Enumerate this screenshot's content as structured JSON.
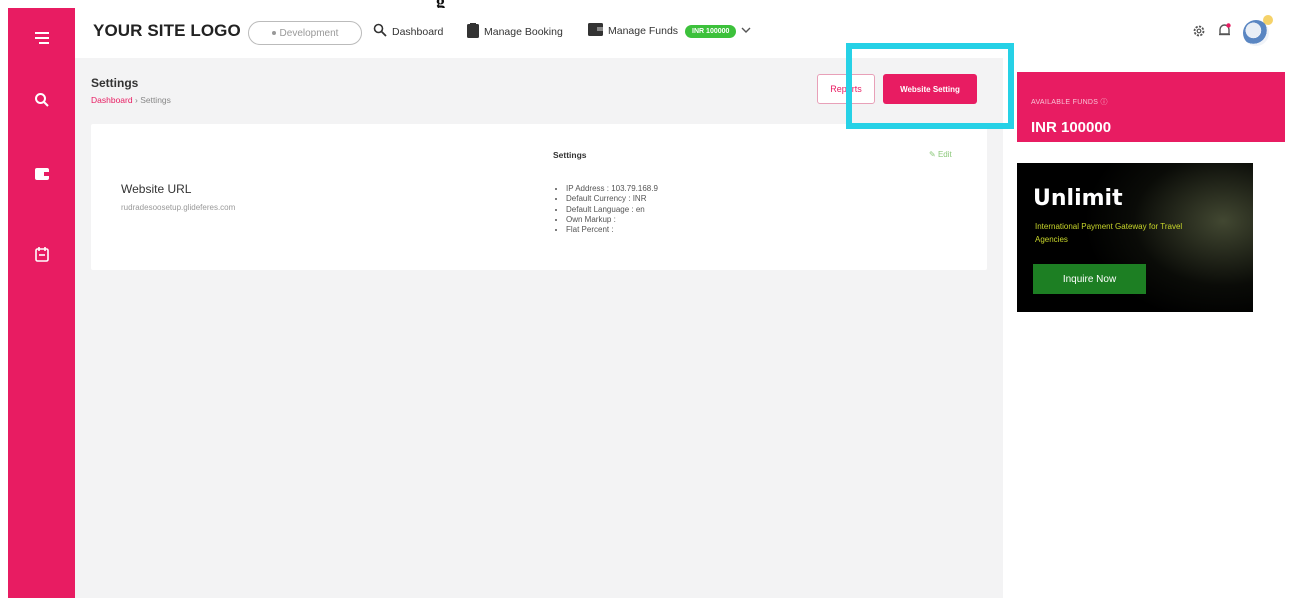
{
  "top_fragment": "g",
  "header": {
    "logo": "YOUR SITE LOGO",
    "environment": "Development",
    "nav": {
      "dashboard": "Dashboard",
      "manage_booking": "Manage Booking",
      "manage_funds": "Manage Funds",
      "funds_badge": "INR 100000"
    }
  },
  "page": {
    "title": "Settings",
    "breadcrumb": {
      "home": "Dashboard",
      "separator": "›",
      "current": "Settings"
    },
    "buttons": {
      "reports": "Reports",
      "website_setting": "Website Setting"
    }
  },
  "settings_card": {
    "url_label": "Website URL",
    "url_value": "rudradesoosetup.glideferes.com",
    "section_title": "Settings",
    "edit_label": "Edit",
    "items": [
      "IP Address : 103.79.168.9",
      "Default Currency : INR",
      "Default Language : en",
      "Own Markup :",
      "Flat Percent :"
    ]
  },
  "funds": {
    "label": "AVAILABLE FUNDS",
    "amount": "INR 100000"
  },
  "ad": {
    "brand": "Unlimit",
    "tagline": "International Payment Gateway for Travel Agencies",
    "cta": "Inquire Now"
  },
  "colors": {
    "brand_pink": "#e81c62",
    "badge_green": "#3cc13b",
    "highlight_cyan": "#26d1e6",
    "ad_green": "#1d7f23"
  }
}
